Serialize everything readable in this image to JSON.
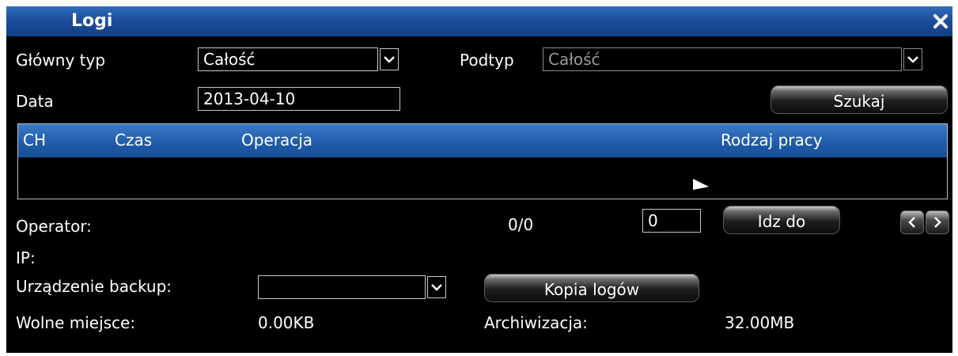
{
  "window": {
    "title": "Logi",
    "close_icon": "close-icon"
  },
  "filters": {
    "main_type_label": "Główny typ",
    "main_type_value": "Całość",
    "subtype_label": "Podtyp",
    "subtype_value": "Całość",
    "date_label": "Data",
    "date_value": "2013-04-10",
    "search_button": "Szukaj"
  },
  "table": {
    "columns": [
      "CH",
      "Czas",
      "Operacja",
      "Rodzaj pracy"
    ],
    "rows": []
  },
  "pagination": {
    "operator_label": "Operator:",
    "ip_label": "IP:",
    "page_count": "0/0",
    "page_input": "0",
    "goto_button": "Idz do"
  },
  "backup": {
    "device_label": "Urządzenie backup:",
    "device_value": "",
    "copy_button": "Kopia logów",
    "free_space_label": "Wolne miejsce:",
    "free_space_value": "0.00KB",
    "archive_label": "Archiwizacja:",
    "archive_value": "32.00MB"
  }
}
